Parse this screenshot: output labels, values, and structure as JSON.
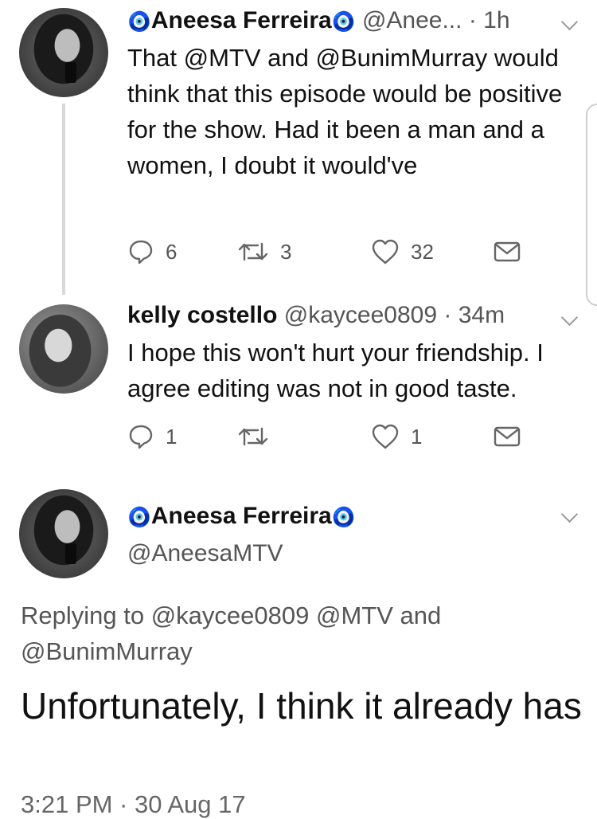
{
  "tweets": [
    {
      "emoji": "🧿",
      "name": "Aneesa Ferreira",
      "handle": "@Anee...",
      "time": "1h",
      "text": "That @MTV and @BunimMurray would think that this episode would be positive for the show. Had it been a man and a women, I doubt it would've",
      "replies": "6",
      "retweets": "3",
      "likes": "32"
    },
    {
      "name": "kelly costello",
      "handle": "@kaycee0809",
      "time": "34m",
      "text": "I hope this won't hurt your friendship. I agree editing was not in good taste.",
      "replies": "1",
      "retweets": "",
      "likes": "1"
    }
  ],
  "main_tweet": {
    "emoji": "🧿",
    "name": "Aneesa Ferreira",
    "handle": "@AneesaMTV",
    "replying_to": "Replying to @kaycee0809 @MTV and @BunimMurray",
    "text": "Unfortunately, I think it already has",
    "timestamp": "3:21 PM · 30 Aug 17"
  }
}
